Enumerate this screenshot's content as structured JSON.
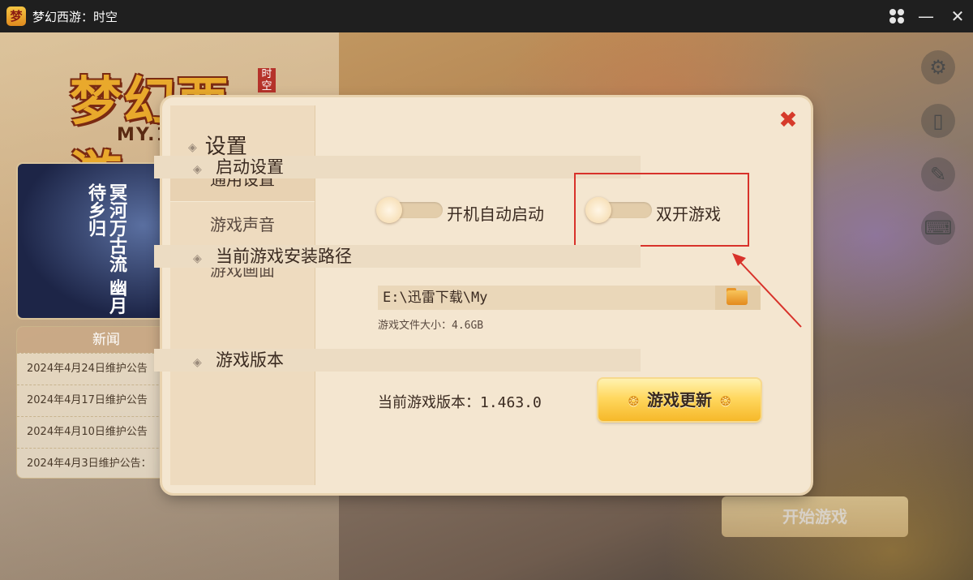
{
  "window": {
    "title": "梦幻西游：时空",
    "app_icon": "梦"
  },
  "background": {
    "game_logo": "梦幻西游",
    "logo_sub": "时空",
    "logo_domain": "MY.16",
    "banner_text": "冥河万古流 幽月待乡归",
    "news_title": "新闻",
    "news_items": [
      "2024年4月24日维护公告",
      "2024年4月17日维护公告",
      "2024年4月10日维护公告",
      "2024年4月3日维护公告："
    ],
    "start_button": "开始游戏",
    "side_icons": [
      "gear-icon",
      "tablet-icon",
      "wrench-icon",
      "keyboard-icon"
    ]
  },
  "settings": {
    "title": "设置",
    "nav": [
      "通用设置",
      "游戏声音",
      "游戏画面"
    ],
    "active_nav": 0,
    "sections": {
      "startup": {
        "title": "启动设置",
        "auto_start_label": "开机自动启动",
        "auto_start_on": false,
        "dual_label": "双开游戏",
        "dual_on": false
      },
      "path": {
        "title": "当前游戏安装路径",
        "value": "E:\\迅雷下载\\My",
        "size_text": "游戏文件大小：4.6GB"
      },
      "version": {
        "title": "游戏版本",
        "current_text": "当前游戏版本：1.463.0",
        "update_button": "游戏更新"
      }
    }
  },
  "colors": {
    "accent_red": "#d8322a",
    "panel_bg": "#f4e6d0",
    "button_gold": "#ffd860"
  }
}
